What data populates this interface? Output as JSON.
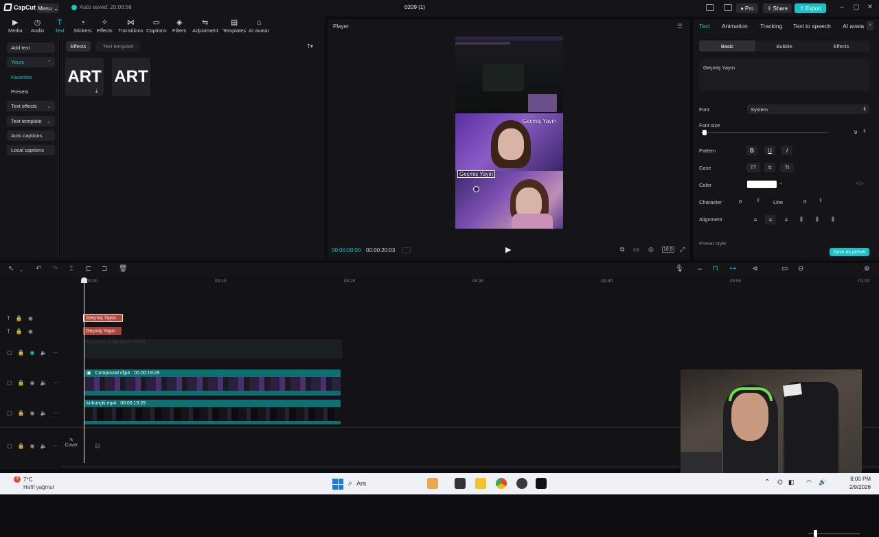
{
  "app": {
    "name": "CapCut",
    "menu_label": "Menu",
    "autosave": "Auto saved: 20:00:58",
    "project_title": "0209 (1)",
    "pro_label": "Pro",
    "share_label": "Share",
    "export_label": "Export"
  },
  "toolbar": {
    "items": [
      "Media",
      "Audio",
      "Text",
      "Stickers",
      "Effects",
      "Transitions",
      "Captions",
      "Filters",
      "Adjustment",
      "Templates",
      "AI avatar"
    ],
    "active": "Text"
  },
  "sidebar": {
    "items": [
      "Add text",
      "Yours",
      "Favorites",
      "Presets",
      "Text effects",
      "Text template",
      "Auto captions",
      "Local captions"
    ]
  },
  "media": {
    "tabs": [
      "Effects",
      "Text template"
    ],
    "tiles": [
      "ART",
      "ART"
    ]
  },
  "player": {
    "title": "Player",
    "overlay_text_top": "Geçmiş Yayın",
    "overlay_text_bottom": "Geçmiş Yayın",
    "current_time": "00:00:00:00",
    "total_time": "00:00:20:03"
  },
  "inspector": {
    "tabs": [
      "Text",
      "Animation",
      "Tracking",
      "Text to speech",
      "AI avata"
    ],
    "active_tab": "Text",
    "subtabs": [
      "Basic",
      "Bubble",
      "Effects"
    ],
    "active_subtab": "Basic",
    "text_value": "Geçmiş Yayın",
    "font_label": "Font",
    "font_value": "System",
    "font_size_label": "Font size",
    "font_size_value": "9",
    "font_size_fraction": 0.02,
    "pattern_label": "Pattern",
    "pattern_buttons": [
      "B",
      "U",
      "I"
    ],
    "case_label": "Case",
    "case_buttons": [
      "TT",
      "tt",
      "Tt"
    ],
    "color_label": "Color",
    "color_value": "#ffffff",
    "character_label": "Character",
    "character_value": "0",
    "line_label": "Line",
    "line_value": "0",
    "alignment_label": "Alignment",
    "preset_style_label": "Preset style",
    "save_preset": "Save as preset"
  },
  "timeline": {
    "ruler": [
      "00:00",
      "00:10",
      "00:20",
      "00:30",
      "00:40",
      "00:50",
      "01:00"
    ],
    "text_clips": [
      "Geçmiş Yayın",
      "Geçmiş Yayın"
    ],
    "hidden_clip": "Compound clip  00:00:20:03",
    "video_clips": [
      {
        "name": "Compound clip4",
        "duration": "00:00:19:29"
      },
      {
        "name": "kırkunçki.mp4",
        "duration": "00:00:19:29"
      }
    ],
    "cover_label": "Cover"
  },
  "taskbar": {
    "weather_temp": "7°C",
    "weather_desc": "Hafif yağmur",
    "search_placeholder": "Ara",
    "time": "8:00 PM",
    "date": "2/9/2026"
  },
  "colors": {
    "accent": "#19c6d0",
    "clip_text": "#c0504d",
    "clip_video": "#0e6f73"
  }
}
